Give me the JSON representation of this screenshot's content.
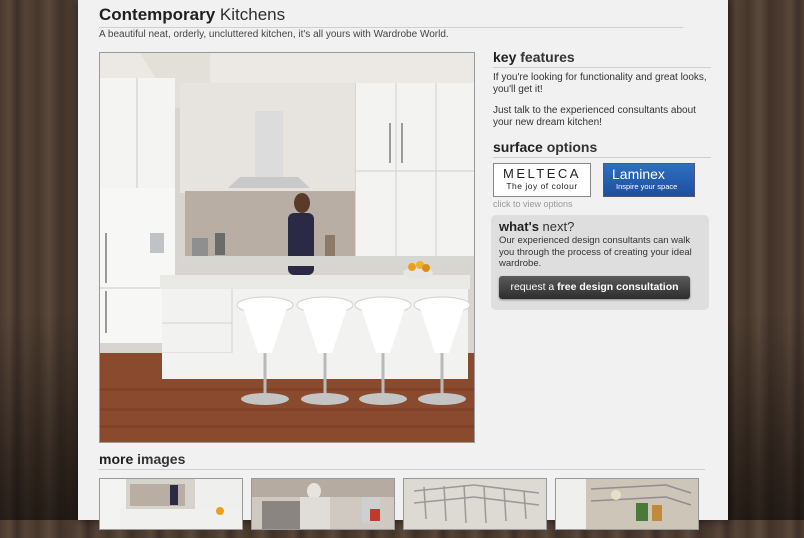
{
  "page": {
    "title_bold": "Contemporary",
    "title_rest": " Kitchens",
    "subtitle": "A beautiful neat, orderly, uncluttered kitchen, it's all yours with Wardrobe World."
  },
  "main_image": {
    "alt": "Kitchen"
  },
  "key_features": {
    "title_bold": "key",
    "title_rest": " features",
    "para1": "If you're looking for functionality and great looks, you'll get it!",
    "para2": "Just talk to the experienced consultants about your new dream kitchen!"
  },
  "surface_options": {
    "title_bold": "surface",
    "title_rest": " options",
    "melteca_name": "MELTECA",
    "melteca_tagline": "The joy of colour",
    "laminex_name": "Laminex",
    "laminex_tagline": "Inspire your space",
    "click_text": "click to view options"
  },
  "whats_next": {
    "title_bold": "what's",
    "title_rest": " next?",
    "text": "Our experienced design consultants can walk you through the process of creating your ideal wardrobe.",
    "cta_prefix": "request a ",
    "cta_bold": "free design consultation"
  },
  "more_images": {
    "title_bold": "more",
    "title_rest": " images",
    "thumbs": [
      "kitchen-island",
      "kitchen-worker",
      "wire-baskets",
      "pull-out-drawer"
    ]
  },
  "colors": {
    "page_bg": "#f1f1f1",
    "wood": "#4a3a30",
    "laminex_blue": "#2e6fbf",
    "cta_dark": "#3a3a3a"
  }
}
